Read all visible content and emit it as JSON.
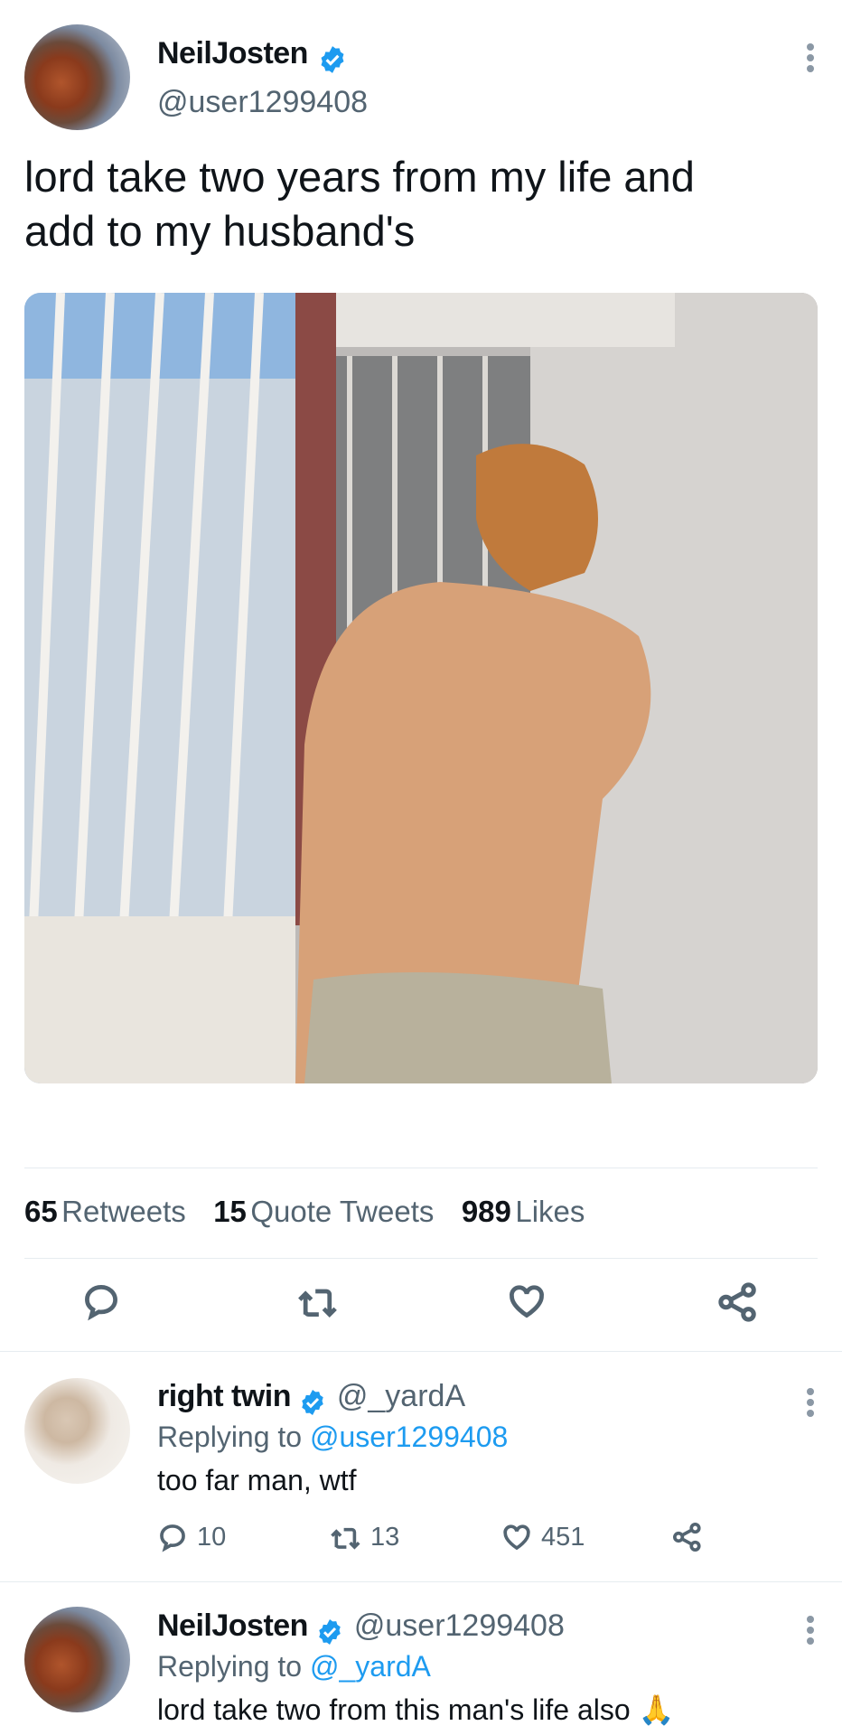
{
  "tweet": {
    "name": "NeilJosten",
    "handle": "@user1299408",
    "text_line1": "lord take two years from my life and",
    "text_line2": "add to my husband's",
    "stats": {
      "retweets_count": "65",
      "retweets_label": "Retweets",
      "quotes_count": "15",
      "quotes_label": "Quote Tweets",
      "likes_count": "989",
      "likes_label": "Likes"
    }
  },
  "replies": [
    {
      "name": "right twin",
      "handle": "@_yardA",
      "replying_prefix": "Replying to",
      "replying_to": "@user1299408",
      "text": "too far man, wtf",
      "reply_count": "10",
      "retweet_count": "13",
      "like_count": "451"
    },
    {
      "name": "NeilJosten",
      "handle": "@user1299408",
      "replying_prefix": "Replying to",
      "replying_to": "@_yardA",
      "text": "lord take two from this man's life also 🙏"
    }
  ],
  "colors": {
    "accent": "#1d9bf0",
    "muted": "#536471",
    "divider": "#e6ecf0"
  },
  "icons": [
    "verified-badge-icon",
    "more-options-icon",
    "reply-icon",
    "retweet-icon",
    "like-icon",
    "share-icon"
  ]
}
